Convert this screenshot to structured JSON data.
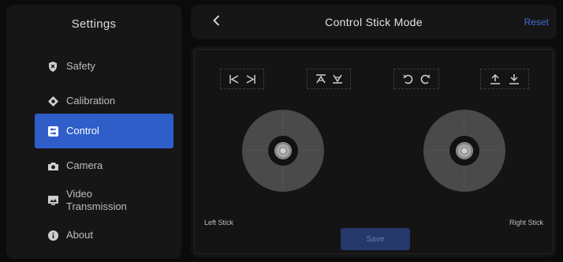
{
  "sidebar": {
    "title": "Settings",
    "items": [
      {
        "label": "Safety",
        "icon": "shield-icon",
        "active": false
      },
      {
        "label": "Calibration",
        "icon": "diamond-icon",
        "active": false
      },
      {
        "label": "Control",
        "icon": "control-icon",
        "active": true
      },
      {
        "label": "Camera",
        "icon": "camera-icon",
        "active": false
      },
      {
        "label": "Video\nTransmission",
        "icon": "video-transmission-icon",
        "active": false
      },
      {
        "label": "About",
        "icon": "info-icon",
        "active": false
      }
    ]
  },
  "header": {
    "back_icon": "chevron-left-icon",
    "title": "Control Stick Mode",
    "reset_label": "Reset"
  },
  "main": {
    "toggles": [
      {
        "name": "yaw-left-right",
        "icons": [
          "yaw-left-icon",
          "yaw-right-icon"
        ]
      },
      {
        "name": "throttle-up-down",
        "icons": [
          "throttle-up-icon",
          "throttle-down-icon"
        ]
      },
      {
        "name": "rotate-ccw-cw",
        "icons": [
          "rotate-ccw-icon",
          "rotate-cw-icon"
        ]
      },
      {
        "name": "ascend-descend",
        "icons": [
          "ascend-icon",
          "descend-icon"
        ]
      }
    ],
    "left_stick_label": "Left Stick",
    "right_stick_label": "Right Stick",
    "save_label": "Save"
  },
  "colors": {
    "accent": "#2f5ec9",
    "reset": "#3d6fd9",
    "save_bg": "#24386a"
  }
}
